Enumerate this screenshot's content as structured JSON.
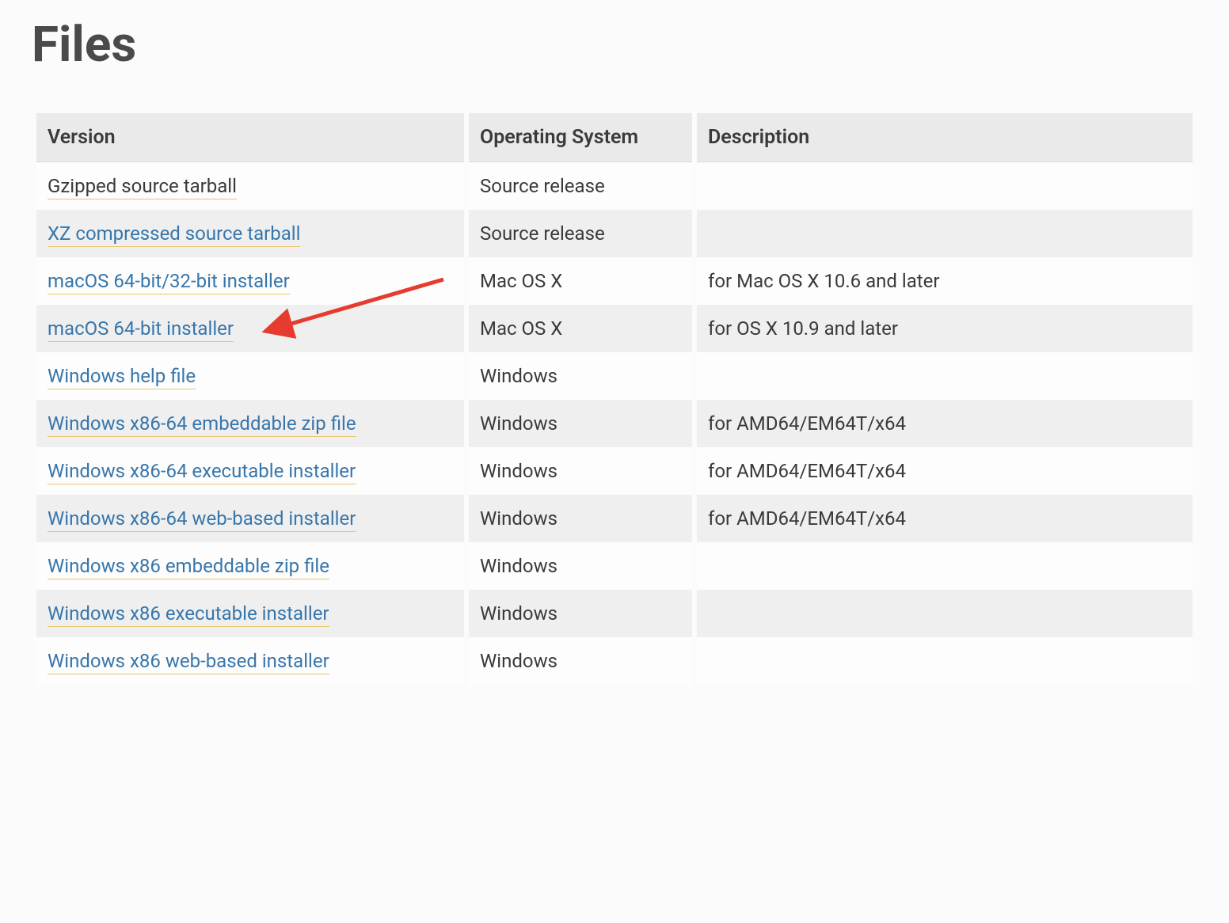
{
  "title": "Files",
  "columns": [
    "Version",
    "Operating System",
    "Description"
  ],
  "rows": [
    {
      "version": "Gzipped source tarball",
      "os": "Source release",
      "desc": "",
      "visited": true
    },
    {
      "version": "XZ compressed source tarball",
      "os": "Source release",
      "desc": "",
      "visited": false
    },
    {
      "version": "macOS 64-bit/32-bit installer",
      "os": "Mac OS X",
      "desc": "for Mac OS X 10.6 and later",
      "visited": false
    },
    {
      "version": "macOS 64-bit installer",
      "os": "Mac OS X",
      "desc": "for OS X 10.9 and later",
      "visited": false
    },
    {
      "version": "Windows help file",
      "os": "Windows",
      "desc": "",
      "visited": false
    },
    {
      "version": "Windows x86-64 embeddable zip file",
      "os": "Windows",
      "desc": "for AMD64/EM64T/x64",
      "visited": false
    },
    {
      "version": "Windows x86-64 executable installer",
      "os": "Windows",
      "desc": "for AMD64/EM64T/x64",
      "visited": false
    },
    {
      "version": "Windows x86-64 web-based installer",
      "os": "Windows",
      "desc": "for AMD64/EM64T/x64",
      "visited": false
    },
    {
      "version": "Windows x86 embeddable zip file",
      "os": "Windows",
      "desc": "",
      "visited": false
    },
    {
      "version": "Windows x86 executable installer",
      "os": "Windows",
      "desc": "",
      "visited": false
    },
    {
      "version": "Windows x86 web-based installer",
      "os": "Windows",
      "desc": "",
      "visited": false
    }
  ],
  "annotation": {
    "type": "arrow",
    "color": "#e63b2e",
    "target_row_index": 3
  }
}
